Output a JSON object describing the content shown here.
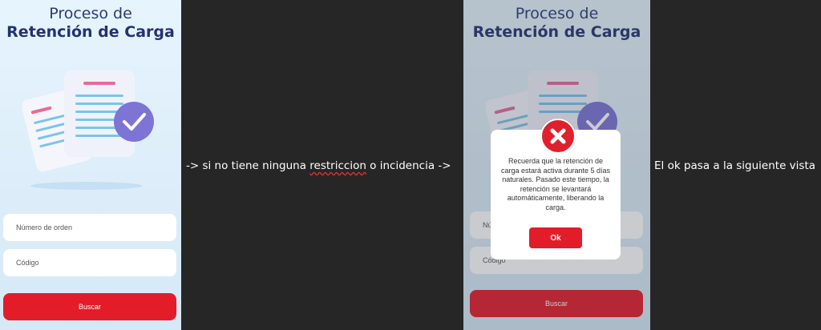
{
  "screen": {
    "title_line1": "Proceso de",
    "title_line2": "Retención de Carga",
    "order_placeholder": "Número de orden",
    "code_placeholder": "Código",
    "search_label": "Buscar"
  },
  "dialog": {
    "message": "Recuerda que la retención de carga estará activa durante 5 días naturales. Pasado este tiempo, la retención se levantará automáticamente, liberando la carga.",
    "ok_label": "Ok"
  },
  "annotations": {
    "flow_before": "-> si no tiene ninguna ",
    "flow_underlined": "restriccion",
    "flow_after": " o incidencia ->",
    "next_step": "El ok pasa a la siguiente vista"
  },
  "colors": {
    "brand_red": "#e31c2a",
    "title_navy": "#233270",
    "canvas_bg": "#262626"
  },
  "icons": [
    "document-check-illustration",
    "error-x-icon"
  ]
}
